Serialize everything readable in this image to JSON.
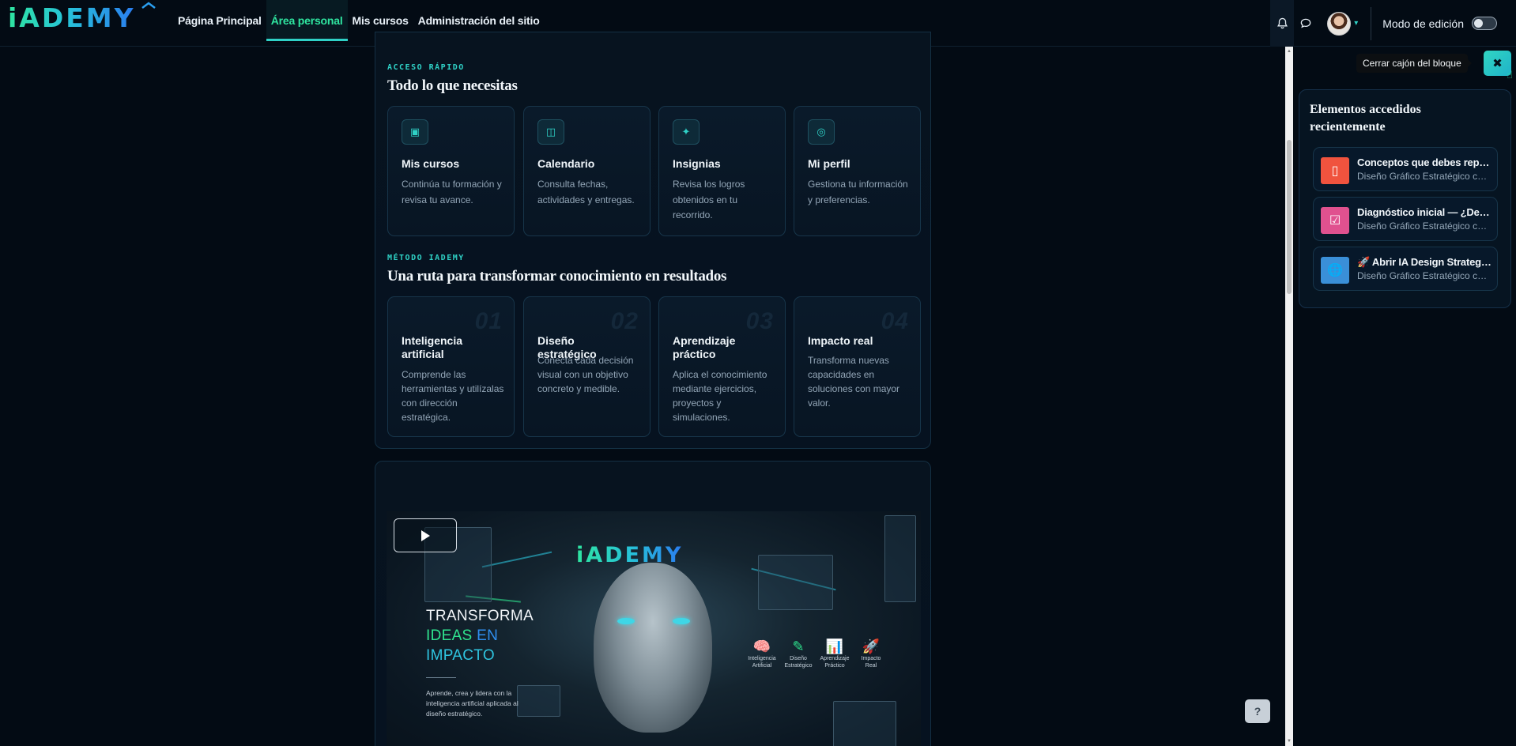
{
  "brand": {
    "logo_text": "iADEMY"
  },
  "nav": {
    "items": [
      {
        "label": "Página Principal",
        "active": false
      },
      {
        "label": "Área personal",
        "active": true
      },
      {
        "label": "Mis cursos",
        "active": false
      },
      {
        "label": "Administración del sitio",
        "active": false
      }
    ],
    "edit_mode_label": "Modo de edición",
    "edit_mode_on": false
  },
  "quick_access": {
    "eyebrow": "ACCESO RÁPIDO",
    "title": "Todo lo que necesitas",
    "tiles": [
      {
        "icon": "square-icon",
        "glyph": "▣",
        "title": "Mis cursos",
        "desc": "Continúa tu formación y revisa tu avance."
      },
      {
        "icon": "calendar-icon",
        "glyph": "◫",
        "title": "Calendario",
        "desc": "Consulta fechas, actividades y entregas."
      },
      {
        "icon": "sparkle-icon",
        "glyph": "✦",
        "title": "Insignias",
        "desc": "Revisa los logros obtenidos en tu recorrido."
      },
      {
        "icon": "target-icon",
        "glyph": "◎",
        "title": "Mi perfil",
        "desc": "Gestiona tu información y preferencias."
      }
    ]
  },
  "method": {
    "eyebrow": "MÉTODO IADEMY",
    "title": "Una ruta para transformar conocimiento en resultados",
    "steps": [
      {
        "num": "01",
        "title": "Inteligencia artificial",
        "desc": "Comprende las herramientas y utilízalas con dirección estratégica."
      },
      {
        "num": "02",
        "title": "Diseño estratégico",
        "desc": "Conecta cada decisión visual con un objetivo concreto y medible."
      },
      {
        "num": "03",
        "title": "Aprendizaje práctico",
        "desc": "Aplica el conocimiento mediante ejercicios, proyectos y simulaciones."
      },
      {
        "num": "04",
        "title": "Impacto real",
        "desc": "Transforma nuevas capacidades en soluciones con mayor valor."
      }
    ]
  },
  "video": {
    "logo_text": "iADEMY",
    "headline_1": "TRANSFORMA",
    "headline_2a": "IDEAS",
    "headline_2b": "EN",
    "headline_3": "IMPACTO",
    "subtitle": "Aprende, crea y lidera con la inteligencia artificial aplicada al diseño estratégico.",
    "icons": [
      {
        "glyph": "🧠",
        "label": "Inteligencia Artificial"
      },
      {
        "glyph": "✎",
        "label": "Diseño Estratégico"
      },
      {
        "glyph": "📊",
        "label": "Aprendizaje Práctico"
      },
      {
        "glyph": "🚀",
        "label": "Impacto Real"
      }
    ]
  },
  "help": {
    "label": "?"
  },
  "drawer": {
    "tooltip": "Cerrar cajón del bloque",
    "close_glyph": "✖",
    "block_title": "Elementos accedidos recientemente",
    "items": [
      {
        "icon": "book-icon",
        "glyph": "▯",
        "color": "#f0533e",
        "title": "Conceptos que debes repasar",
        "course": "Diseño Gráfico Estratégico con IA"
      },
      {
        "icon": "check-icon",
        "glyph": "☑",
        "color": "#e0518f",
        "title": "Diagnóstico inicial — ¿Desde dónde partes?",
        "course": "Diseño Gráfico Estratégico con IA"
      },
      {
        "icon": "globe-icon",
        "glyph": "🌐",
        "color": "#3a8fd8",
        "title": "🚀 Abrir IA Design Strategy Lab",
        "course": "Diseño Gráfico Estratégico con IA"
      }
    ]
  },
  "colors": {
    "accent": "#2fd1c6",
    "accent_green": "#2fe5a0",
    "background": "#030b14"
  }
}
